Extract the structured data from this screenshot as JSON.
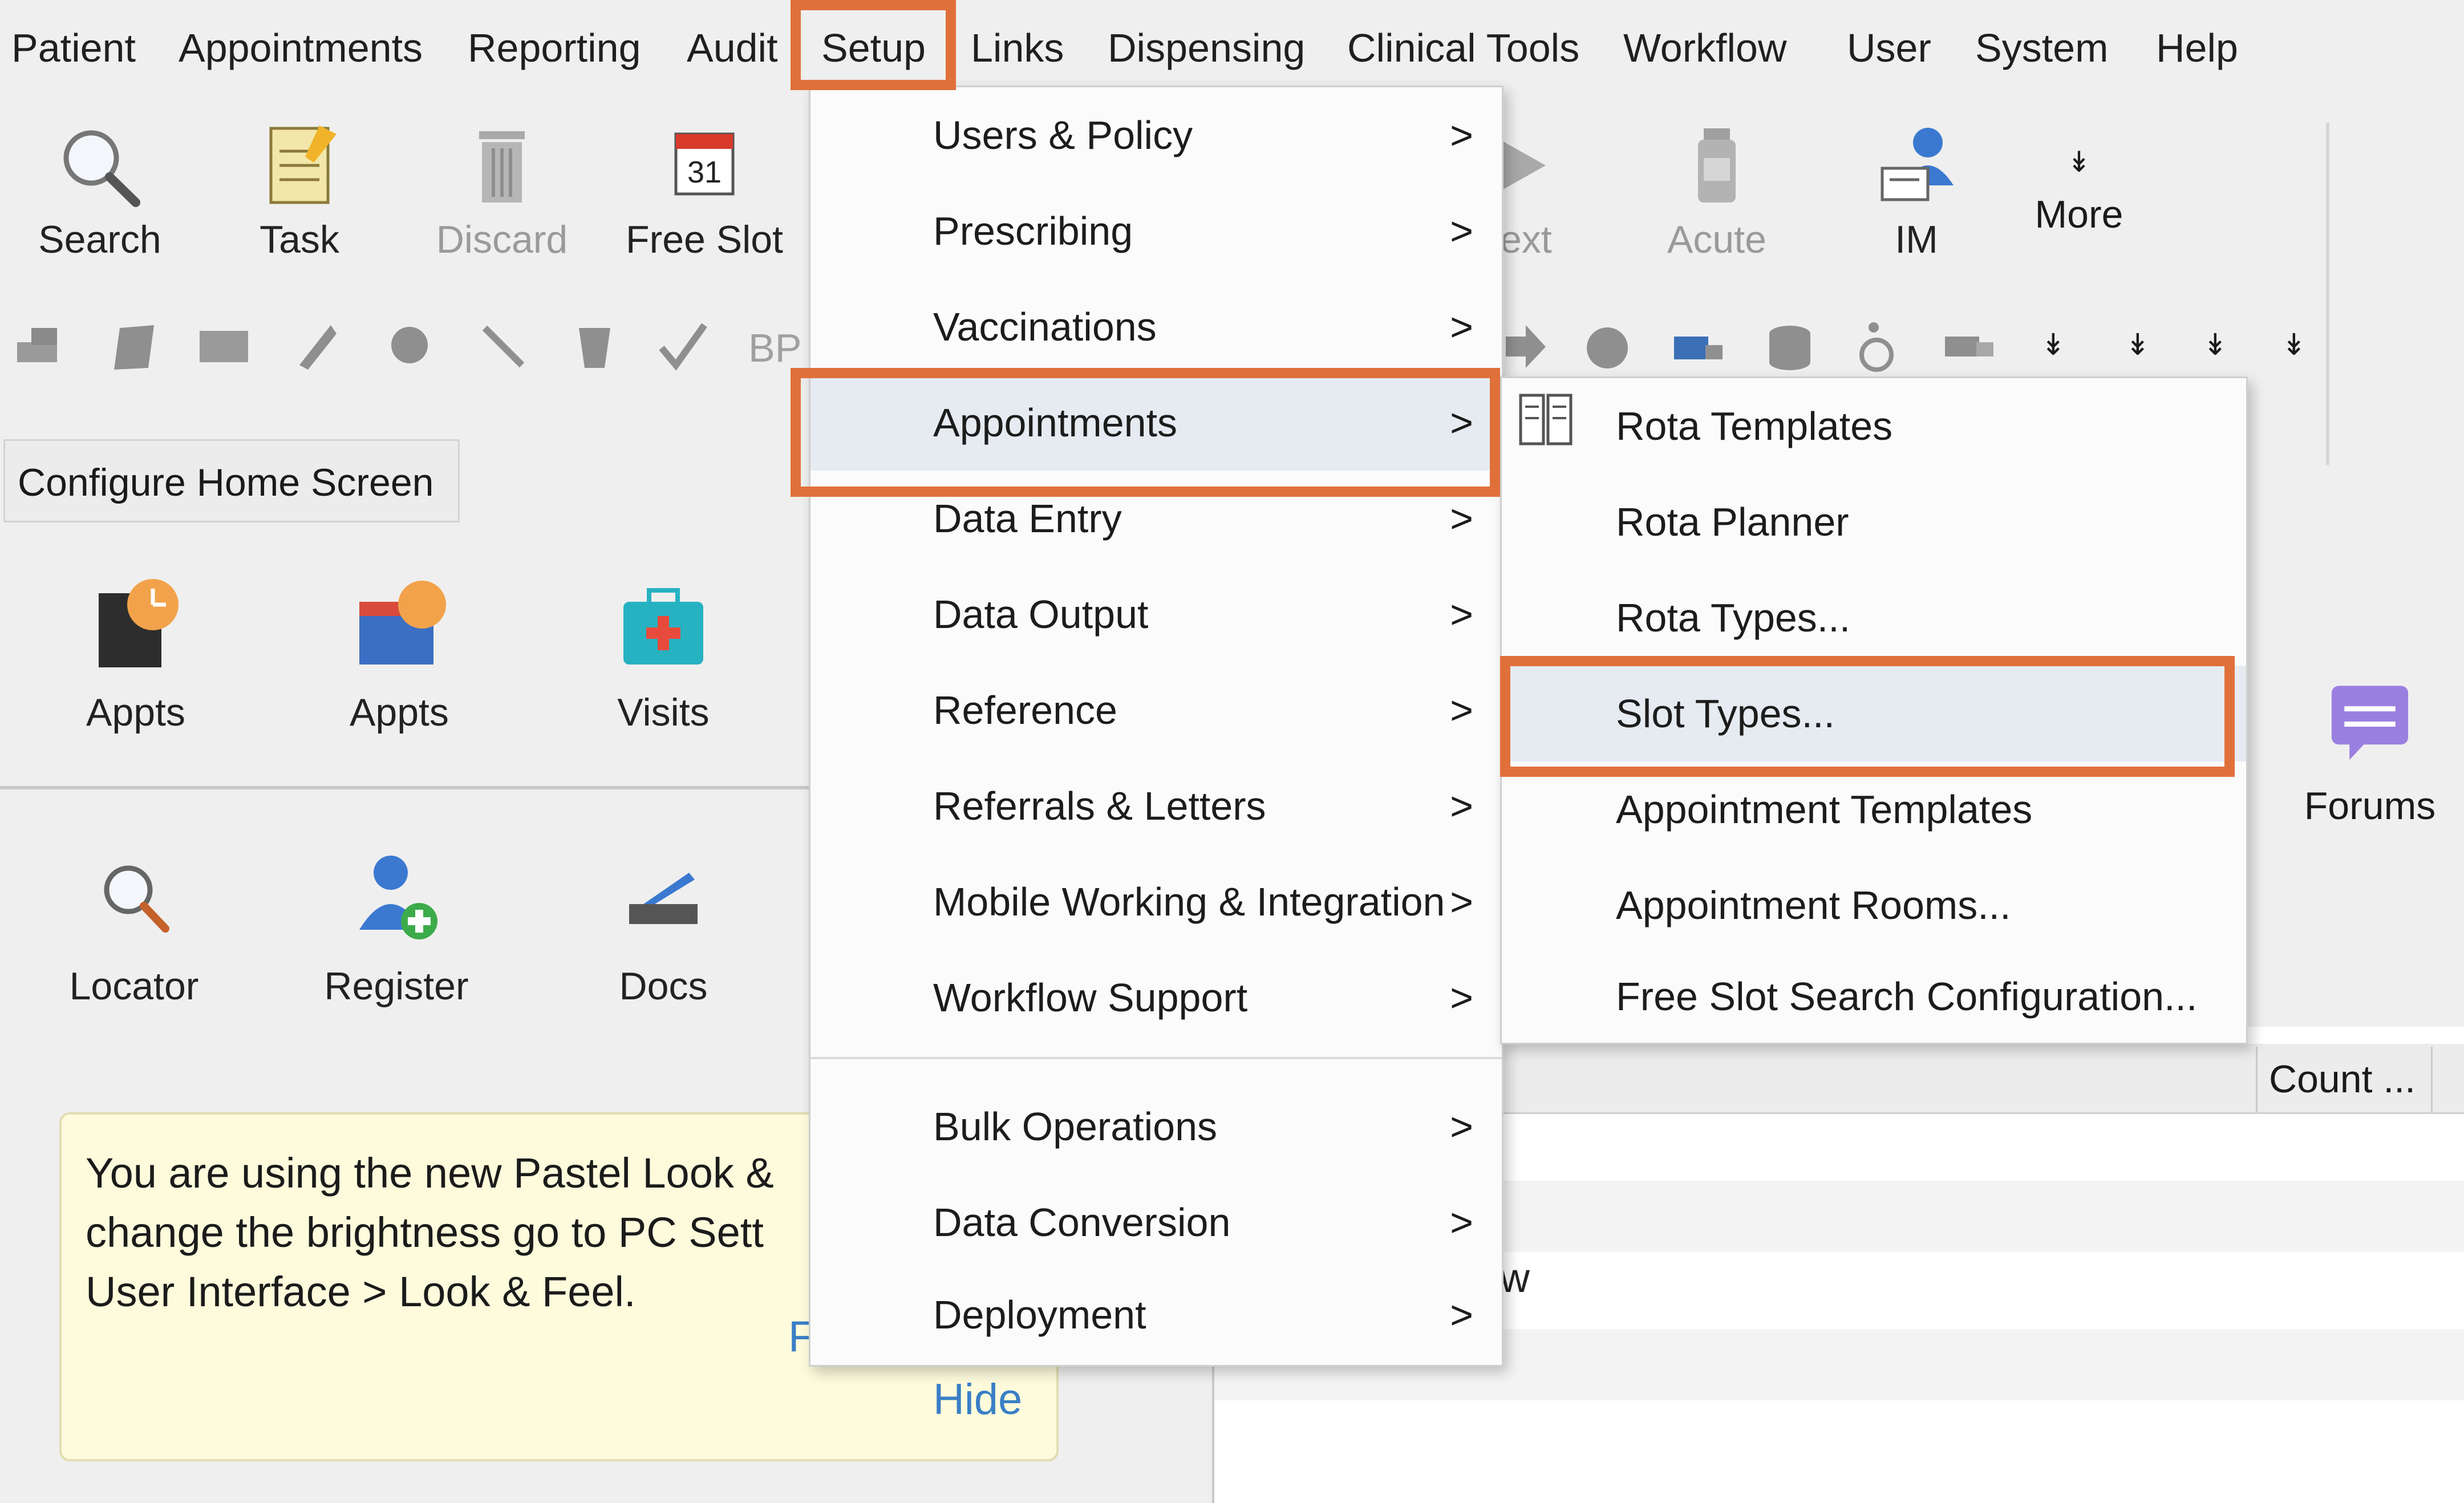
{
  "menubar": {
    "items": [
      "Patient",
      "Appointments",
      "Reporting",
      "Audit",
      "Setup",
      "Links",
      "Dispensing",
      "Clinical Tools",
      "Workflow",
      "User",
      "System",
      "Help"
    ]
  },
  "toolbar": {
    "search": "Search",
    "task": "Task",
    "discard": "Discard",
    "free_slot": "Free Slot",
    "next_partial": "ext",
    "acute": "Acute",
    "im": "IM",
    "more": "More",
    "calendar_day": "31",
    "bp_partial": "BP"
  },
  "configure_home": "Configure Home Screen",
  "home_tiles": {
    "appts1": "Appts",
    "appts2": "Appts",
    "visits": "Visits",
    "locator": "Locator",
    "register": "Register",
    "docs": "Docs",
    "forums": "Forums"
  },
  "notice": {
    "text": "You are using the new Pastel Look &\nchange the brightness go to PC Sett\nUser Interface > Look & Feel.",
    "hide": "Hide",
    "partial_link": "F"
  },
  "right_panel": {
    "count_header": "Count ...",
    "partial_text": "w"
  },
  "setup_menu": {
    "items": [
      {
        "label": "Users & Policy",
        "chevron": ">"
      },
      {
        "label": "Prescribing",
        "chevron": ">"
      },
      {
        "label": "Vaccinations",
        "chevron": ">"
      },
      {
        "label": "Appointments",
        "chevron": ">"
      },
      {
        "label": "Data Entry",
        "chevron": ">"
      },
      {
        "label": "Data Output",
        "chevron": ">"
      },
      {
        "label": "Reference",
        "chevron": ">"
      },
      {
        "label": "Referrals & Letters",
        "chevron": ">"
      },
      {
        "label": "Mobile Working & Integration",
        "chevron": ">"
      },
      {
        "label": "Workflow Support",
        "chevron": ">"
      },
      {
        "label": "Bulk Operations",
        "chevron": ">"
      },
      {
        "label": "Data Conversion",
        "chevron": ">"
      },
      {
        "label": "Deployment",
        "chevron": ">"
      }
    ]
  },
  "appointments_submenu": {
    "items": [
      "Rota Templates",
      "Rota Planner",
      "Rota Types...",
      "Slot Types...",
      "Appointment Templates",
      "Appointment Rooms...",
      "Free Slot Search Configuration..."
    ]
  },
  "colors": {
    "highlight": "#e0703a",
    "menu_active": "#e6ebf2",
    "link": "#3a7fc6",
    "notice_bg": "#fdfbdc"
  }
}
